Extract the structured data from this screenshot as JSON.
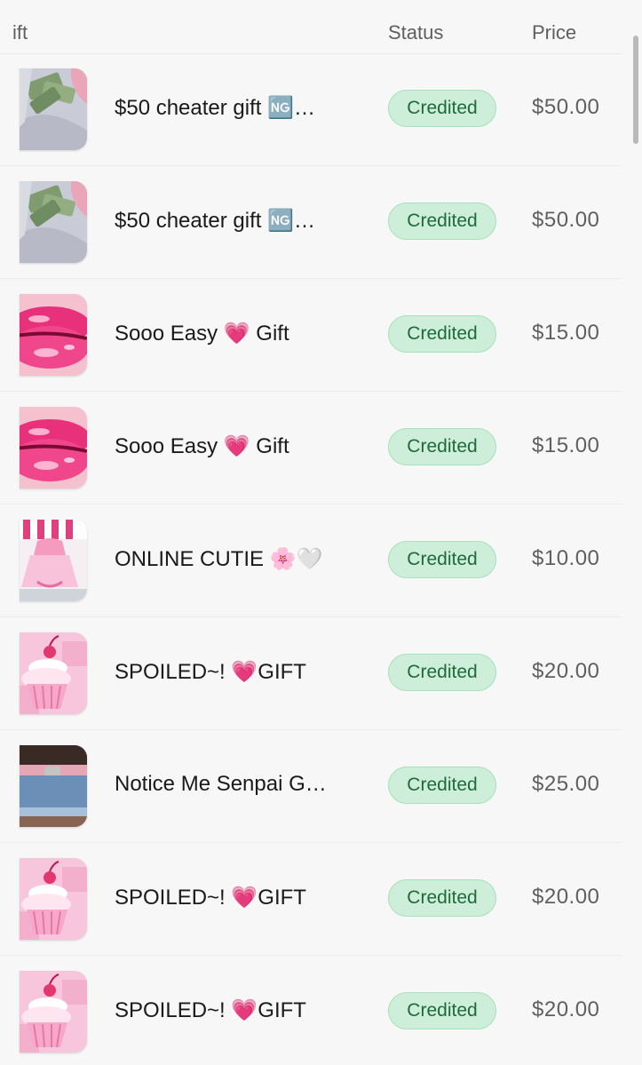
{
  "header": {
    "gift_label": "ift",
    "status_label": "Status",
    "price_label": "Price"
  },
  "rows": [
    {
      "name": "$50 cheater gift 🆖…",
      "status": "Credited",
      "price": "$50.00",
      "thumb_icon": "money-sweater-thumbnail"
    },
    {
      "name": "$50 cheater gift 🆖…",
      "status": "Credited",
      "price": "$50.00",
      "thumb_icon": "money-sweater-thumbnail"
    },
    {
      "name": "Sooo Easy 💗 Gift",
      "status": "Credited",
      "price": "$15.00",
      "thumb_icon": "pink-lips-thumbnail"
    },
    {
      "name": "Sooo Easy 💗 Gift",
      "status": "Credited",
      "price": "$15.00",
      "thumb_icon": "pink-lips-thumbnail"
    },
    {
      "name": "ONLINE CUTIE 🌸🤍",
      "status": "Credited",
      "price": "$10.00",
      "thumb_icon": "pink-outfit-thumbnail"
    },
    {
      "name": "SPOILED~! 💗GIFT",
      "status": "Credited",
      "price": "$20.00",
      "thumb_icon": "pink-cupcake-thumbnail"
    },
    {
      "name": "Notice Me Senpai G…",
      "status": "Credited",
      "price": "$25.00",
      "thumb_icon": "denim-skirt-thumbnail"
    },
    {
      "name": "SPOILED~! 💗GIFT",
      "status": "Credited",
      "price": "$20.00",
      "thumb_icon": "pink-cupcake-thumbnail"
    },
    {
      "name": "SPOILED~! 💗GIFT",
      "status": "Credited",
      "price": "$20.00",
      "thumb_icon": "pink-cupcake-thumbnail"
    }
  ],
  "colors": {
    "badge_bg": "#cdeed8",
    "badge_text": "#1f6a3a",
    "header_text": "#5f5f5f"
  }
}
